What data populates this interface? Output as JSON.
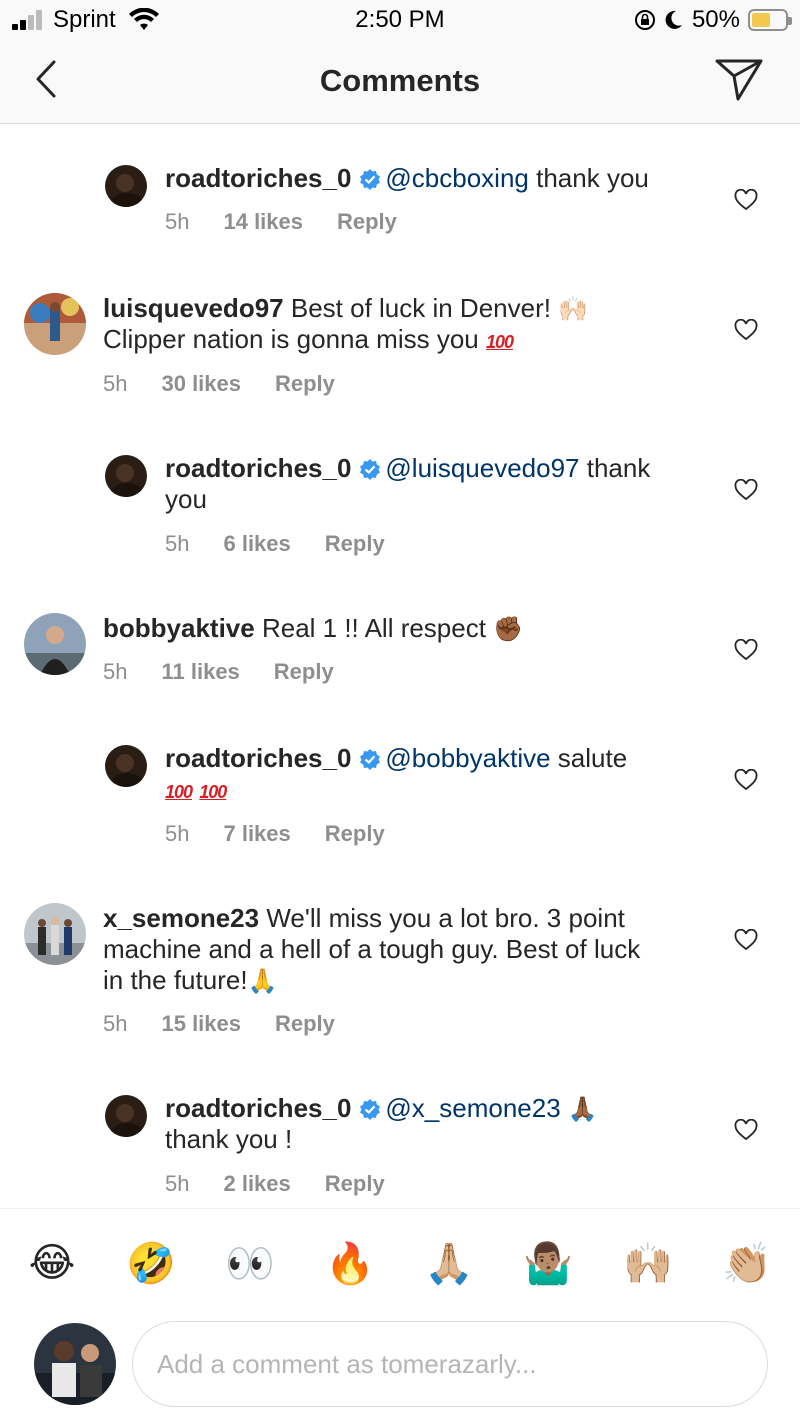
{
  "status_bar": {
    "carrier": "Sprint",
    "time": "2:50 PM",
    "battery": "50%",
    "battery_level": 0.5
  },
  "header": {
    "title": "Comments",
    "back_icon": "chevron-left-icon",
    "action_icon": "direct-send-icon"
  },
  "comments": [
    {
      "username": "roadtoriches_0",
      "verified": true,
      "mention": "@cbcboxing",
      "text": "thank you",
      "time": "5h",
      "likes": "14 likes",
      "reply": "Reply",
      "is_reply": true
    },
    {
      "username": "luisquevedo97",
      "verified": false,
      "text": "Best of luck in Denver! 🙌🏻 Clipper nation is gonna miss you 💯",
      "text_line1": "Best of luck in Denver!",
      "text_line2": "Clipper nation is gonna miss you",
      "time": "5h",
      "likes": "30 likes",
      "reply": "Reply",
      "is_reply": false
    },
    {
      "username": "roadtoriches_0",
      "verified": true,
      "mention": "@luisquevedo97",
      "text": "thank you",
      "time": "5h",
      "likes": "6 likes",
      "reply": "Reply",
      "is_reply": true
    },
    {
      "username": "bobbyaktive",
      "verified": false,
      "text": "Real 1 !! All respect",
      "time": "5h",
      "likes": "11 likes",
      "reply": "Reply",
      "is_reply": false
    },
    {
      "username": "roadtoriches_0",
      "verified": true,
      "mention": "@bobbyaktive",
      "text": "salute",
      "time": "5h",
      "likes": "7 likes",
      "reply": "Reply",
      "is_reply": true
    },
    {
      "username": "x_semone23",
      "verified": false,
      "text": "We'll miss you a lot bro. 3 point machine and a hell of a tough guy. Best of luck in the future!",
      "text_line1": "We'll miss you a lot bro. 3 point",
      "text_line2": "machine and a hell of a tough guy. Best of luck",
      "text_line3": "in the future!",
      "time": "5h",
      "likes": "15 likes",
      "reply": "Reply",
      "is_reply": false
    },
    {
      "username": "roadtoriches_0",
      "verified": true,
      "mention": "@x_semone23",
      "text": "thank you !",
      "time": "5h",
      "likes": "2 likes",
      "reply": "Reply",
      "is_reply": true
    }
  ],
  "quick_emojis": [
    "😂",
    "🤣",
    "👀",
    "🔥",
    "🙏🏼",
    "🤷🏽‍♂️",
    "🙌🏼",
    "👏🏼"
  ],
  "hundred_label": "100",
  "composer": {
    "placeholder": "Add a comment as tomerazarly..."
  },
  "colors": {
    "mention": "#003569",
    "verified": "#3897f0",
    "meta": "#8e8e8e",
    "text": "#262626"
  }
}
